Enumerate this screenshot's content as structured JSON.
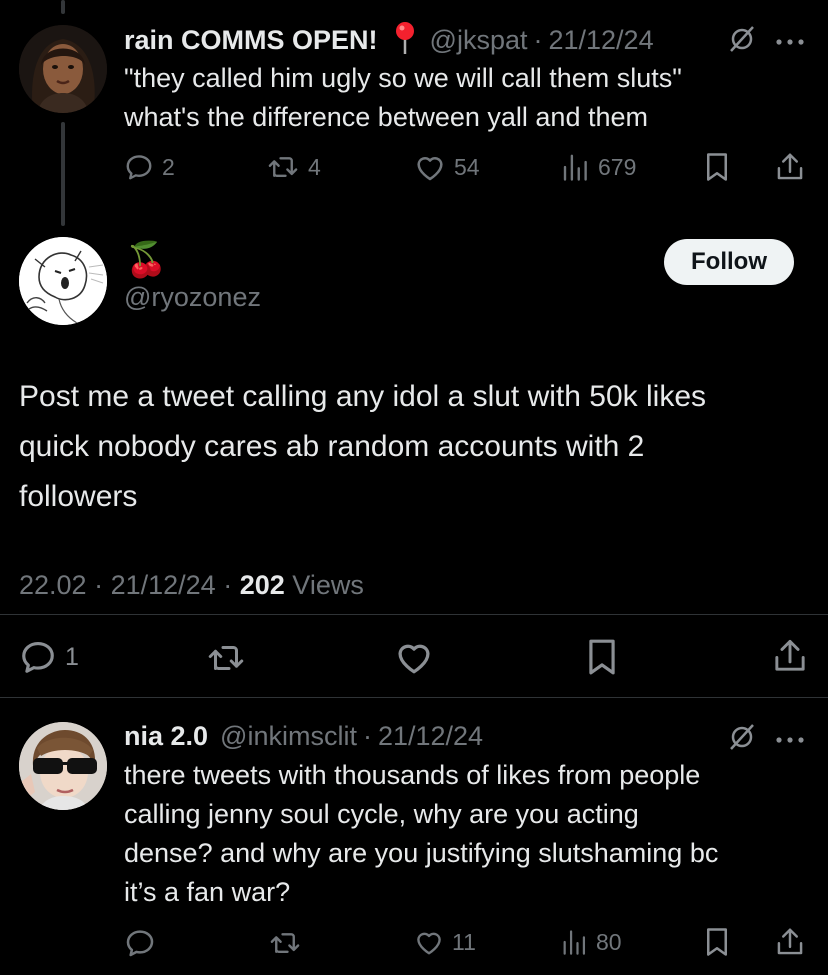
{
  "tweet1": {
    "name": "rain COMMS OPEN!",
    "handle": "@jkspat",
    "date": "21/12/24",
    "line1": "\"they called him ugly so we will call them sluts\"",
    "line2": "what's the difference between yall and them",
    "replies": "2",
    "retweets": "4",
    "likes": "54",
    "views": "679"
  },
  "main": {
    "emoji": "🍒",
    "handle": "@ryozonez",
    "follow_label": "Follow",
    "line1": "Post me a tweet calling any idol a slut with 50k likes",
    "line2": "quick nobody cares ab random accounts with 2",
    "line3": "followers",
    "time": "22.02",
    "date": "21/12/24",
    "views_count": "202",
    "views_label": "Views",
    "replies": "1"
  },
  "tweet3": {
    "name": "nia 2.0",
    "handle": "@inkimsclit",
    "date": "21/12/24",
    "line1": "there tweets with thousands of likes from people",
    "line2": "calling jenny soul cycle, why are you acting",
    "line3": "dense? and why are you justifying slutshaming bc",
    "line4": "it’s a fan war?",
    "likes": "11",
    "views": "80"
  },
  "colors": {
    "background": "#000000",
    "text": "#e7e9ea",
    "muted": "#71767b",
    "pin": "#f4212e"
  }
}
